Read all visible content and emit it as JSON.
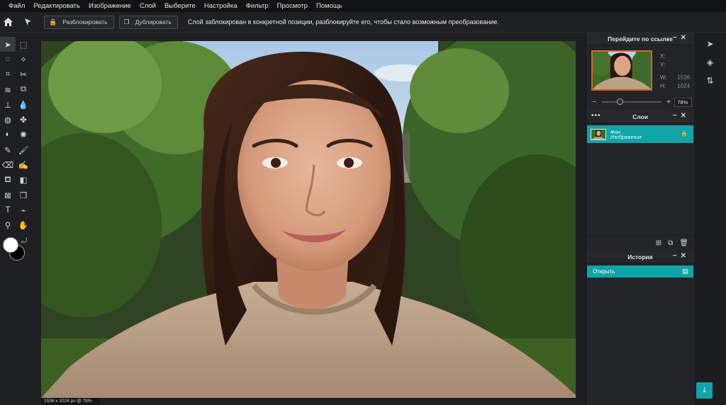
{
  "menu": [
    "Файл",
    "Редактировать",
    "Изображение",
    "Слой",
    "Выберите",
    "Настройка",
    "Фильтр",
    "Просмотр",
    "Помощь"
  ],
  "toolbar": {
    "unlock_label": "Разблокировать",
    "duplicate_label": "Дублировать",
    "message": "Слой заблокирован в конкретной позиции, разблокируйте его, чтобы стало возможным преобразование."
  },
  "tools": [
    {
      "name": "move-tool",
      "glyph": "➤"
    },
    {
      "name": "marquee-tool",
      "glyph": "⬚"
    },
    {
      "name": "lasso-tool",
      "glyph": "◌"
    },
    {
      "name": "magic-wand-tool",
      "glyph": "✧"
    },
    {
      "name": "crop-tool",
      "glyph": "⌗"
    },
    {
      "name": "cut-tool",
      "glyph": "✂"
    },
    {
      "name": "liquify-tool",
      "glyph": "≋"
    },
    {
      "name": "bandage-tool",
      "glyph": "⧉"
    },
    {
      "name": "stamp-tool",
      "glyph": "⊥"
    },
    {
      "name": "drop-tool",
      "glyph": "💧"
    },
    {
      "name": "sphere-tool",
      "glyph": "◍"
    },
    {
      "name": "blob-tool",
      "glyph": "✤"
    },
    {
      "name": "dodge-tool",
      "glyph": "◐"
    },
    {
      "name": "sponge-tool",
      "glyph": "✺"
    },
    {
      "name": "pencil-tool",
      "glyph": "✎"
    },
    {
      "name": "brush-tool",
      "glyph": "🖌"
    },
    {
      "name": "eraser-tool",
      "glyph": "⌫"
    },
    {
      "name": "smudge-tool",
      "glyph": "✍"
    },
    {
      "name": "fill-tool",
      "glyph": "⛾"
    },
    {
      "name": "gradient-tool",
      "glyph": "◧"
    },
    {
      "name": "shape-tool",
      "glyph": "⊠"
    },
    {
      "name": "clone-tool",
      "glyph": "❐"
    },
    {
      "name": "text-tool",
      "glyph": "T"
    },
    {
      "name": "eyedropper-tool",
      "glyph": "⌁"
    },
    {
      "name": "zoom-tool",
      "glyph": "⚲"
    },
    {
      "name": "hand-tool",
      "glyph": "✋"
    }
  ],
  "status": "1536 x 1024 px @ 78%",
  "navigator": {
    "title": "Перейдите по ссылке",
    "x_label": "X:",
    "x_value": "",
    "y_label": "Y:",
    "y_value": "",
    "w_label": "W:",
    "w_value": "1536",
    "h_label": "H:",
    "h_value": "1024",
    "zoom": "78%",
    "zoom_fraction": 0.3
  },
  "layers": {
    "title": "Слои",
    "items": [
      {
        "name": "Фон",
        "type": "Изображение"
      }
    ]
  },
  "history": {
    "title": "История",
    "items": [
      {
        "label": "Открыть"
      }
    ]
  },
  "colors": {
    "accent": "#0ea4a8",
    "nav_frame": "#d6632a"
  }
}
